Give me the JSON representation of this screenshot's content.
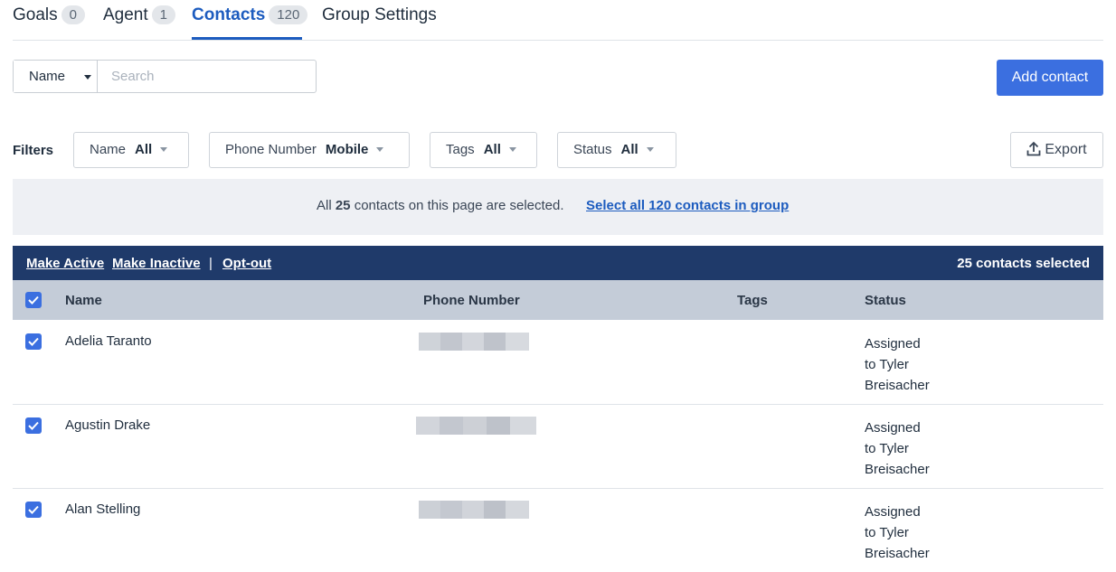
{
  "tabs": [
    {
      "label": "Goals",
      "count": "0"
    },
    {
      "label": "Agent",
      "count": "1"
    },
    {
      "label": "Contacts",
      "count": "120"
    },
    {
      "label": "Group Settings"
    }
  ],
  "search": {
    "field": "Name",
    "placeholder": "Search"
  },
  "add_contact_label": "Add contact",
  "filters": {
    "label": "Filters",
    "items": [
      {
        "name": "Name",
        "value": "All"
      },
      {
        "name": "Phone Number",
        "value": "Mobile"
      },
      {
        "name": "Tags",
        "value": "All"
      },
      {
        "name": "Status",
        "value": "All"
      }
    ],
    "export_label": "Export"
  },
  "notice": {
    "prefix": "All",
    "count": "25",
    "suffix": "contacts on this page are selected.",
    "link": "Select all 120 contacts in group"
  },
  "actions": {
    "make_active": "Make Active",
    "make_inactive": "Make Inactive",
    "separator": "|",
    "opt_out": "Opt-out",
    "selected_count": "25 contacts selected"
  },
  "table": {
    "columns": [
      "Name",
      "Phone Number",
      "Tags",
      "Status"
    ],
    "rows": [
      {
        "name": "Adelia Taranto",
        "status": [
          "Assigned",
          "to Tyler",
          "Breisacher"
        ]
      },
      {
        "name": "Agustin Drake",
        "status": [
          "Assigned",
          "to Tyler",
          "Breisacher"
        ]
      },
      {
        "name": "Alan Stelling",
        "status": [
          "Assigned",
          "to Tyler",
          "Breisacher"
        ]
      }
    ]
  },
  "colors": {
    "accent": "#3b6fe0",
    "link": "#1d5cbf",
    "actions_bar": "#1f3a6a",
    "header_bg": "#c4ccd8",
    "notice_bg": "#eef0f4"
  },
  "icons": {
    "checkbox": "check-icon",
    "export": "upload-icon",
    "dropdown": "caret-down-icon"
  }
}
